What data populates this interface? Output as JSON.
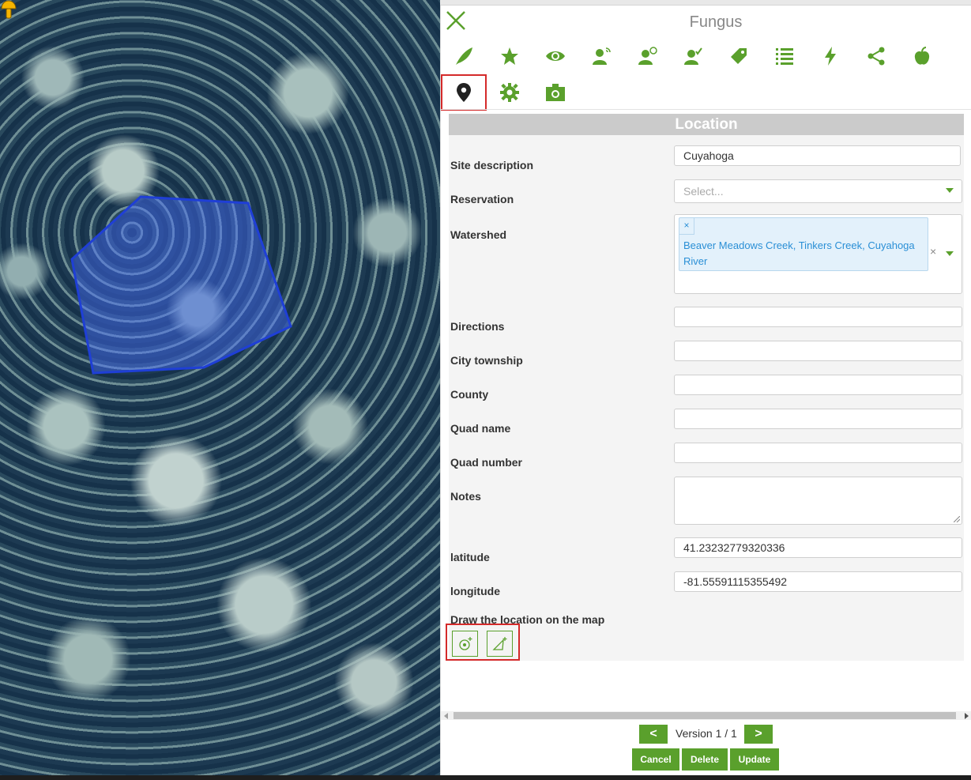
{
  "panel": {
    "title": "Fungus"
  },
  "icons_row_1": [
    "feather-icon",
    "star-icon",
    "eye-icon",
    "person-signal-icon",
    "person-clock-icon",
    "person-check-icon",
    "tag-icon",
    "list-icon",
    "lightning-icon",
    "share-icon",
    "apple-icon"
  ],
  "icons_row_2": [
    "map-pin-icon",
    "gear-icon",
    "camera-icon"
  ],
  "section": {
    "title": "Location"
  },
  "form": {
    "site_description": {
      "label": "Site description",
      "value": "Cuyahoga"
    },
    "reservation": {
      "label": "Reservation",
      "placeholder": "Select..."
    },
    "watershed": {
      "label": "Watershed",
      "tag_remove": "×",
      "tag_text": "Beaver Meadows Creek, Tinkers Creek, Cuyahoga River",
      "clear": "×"
    },
    "directions": {
      "label": "Directions",
      "value": ""
    },
    "city_township": {
      "label": "City township",
      "value": ""
    },
    "county": {
      "label": "County",
      "value": ""
    },
    "quad_name": {
      "label": "Quad name",
      "value": ""
    },
    "quad_number": {
      "label": "Quad number",
      "value": ""
    },
    "notes": {
      "label": "Notes",
      "value": ""
    },
    "latitude": {
      "label": "latitude",
      "value": "41.23232779320336"
    },
    "longitude": {
      "label": "longitude",
      "value": "-81.55591115355492"
    },
    "draw": {
      "label": "Draw the location on the map"
    }
  },
  "version": {
    "prev": "<",
    "text": "Version 1 / 1",
    "next": ">"
  },
  "actions": {
    "cancel": "Cancel",
    "delete": "Delete",
    "update": "Update"
  },
  "colors": {
    "accent": "#5aa02c",
    "highlight": "#d42a2a",
    "polygon": "#1f3fd6",
    "marker": "#f5b400"
  }
}
